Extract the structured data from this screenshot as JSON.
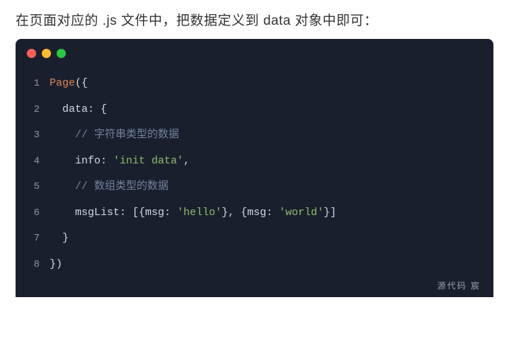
{
  "heading": "在页面对应的 .js 文件中，把数据定义到 data 对象中即可：",
  "watermark": "源代码  宸",
  "code": {
    "lines": [
      {
        "n": "1",
        "tokens": [
          {
            "t": "Page",
            "c": "tok-func"
          },
          {
            "t": "({",
            "c": "tok-punc"
          }
        ]
      },
      {
        "n": "2",
        "tokens": [
          {
            "t": "  ",
            "c": "tok-punc"
          },
          {
            "t": "data",
            "c": "tok-key"
          },
          {
            "t": ": {",
            "c": "tok-punc"
          }
        ]
      },
      {
        "n": "3",
        "tokens": [
          {
            "t": "    ",
            "c": "tok-punc"
          },
          {
            "t": "// 字符串类型的数据",
            "c": "tok-comment"
          }
        ]
      },
      {
        "n": "4",
        "tokens": [
          {
            "t": "    ",
            "c": "tok-punc"
          },
          {
            "t": "info",
            "c": "tok-key"
          },
          {
            "t": ": ",
            "c": "tok-punc"
          },
          {
            "t": "'init data'",
            "c": "tok-string"
          },
          {
            "t": ",",
            "c": "tok-punc"
          }
        ]
      },
      {
        "n": "5",
        "tokens": [
          {
            "t": "    ",
            "c": "tok-punc"
          },
          {
            "t": "// 数组类型的数据",
            "c": "tok-comment"
          }
        ]
      },
      {
        "n": "6",
        "tokens": [
          {
            "t": "    ",
            "c": "tok-punc"
          },
          {
            "t": "msgList",
            "c": "tok-key"
          },
          {
            "t": ": [{",
            "c": "tok-punc"
          },
          {
            "t": "msg",
            "c": "tok-key"
          },
          {
            "t": ": ",
            "c": "tok-punc"
          },
          {
            "t": "'hello'",
            "c": "tok-string"
          },
          {
            "t": "}, {",
            "c": "tok-punc"
          },
          {
            "t": "msg",
            "c": "tok-key"
          },
          {
            "t": ": ",
            "c": "tok-punc"
          },
          {
            "t": "'world'",
            "c": "tok-string"
          },
          {
            "t": "}]",
            "c": "tok-punc"
          }
        ]
      },
      {
        "n": "7",
        "tokens": [
          {
            "t": "  }",
            "c": "tok-punc"
          }
        ]
      },
      {
        "n": "8",
        "tokens": [
          {
            "t": "})",
            "c": "tok-punc"
          }
        ]
      }
    ]
  }
}
